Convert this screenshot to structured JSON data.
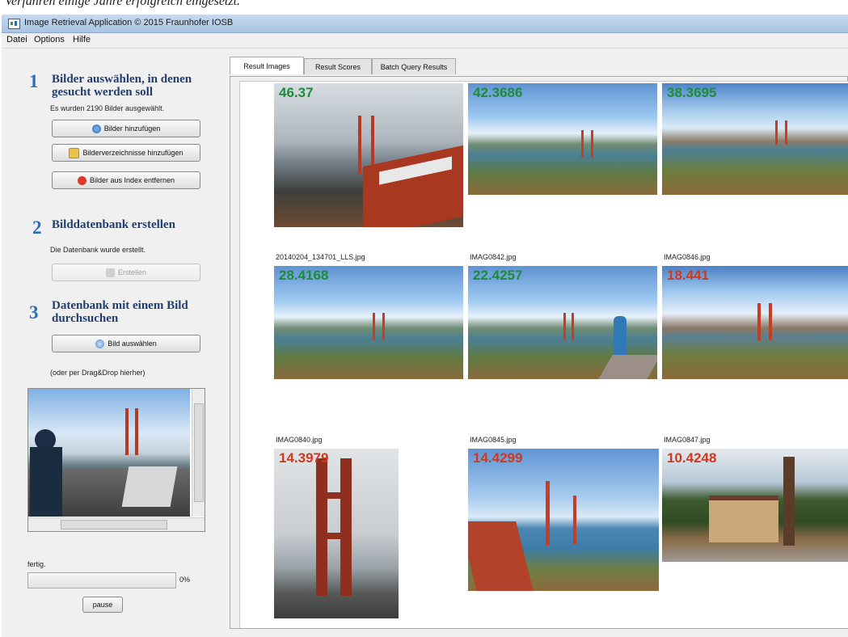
{
  "caption": "Verfahren einige Jahre erfolgreich eingesetzt.",
  "window": {
    "title": "Image Retrieval Application © 2015 Fraunhofer IOSB"
  },
  "menu": [
    "Datei",
    "Options",
    "Hilfe"
  ],
  "steps": {
    "one": {
      "number": "1",
      "heading_line1": "Bilder auswählen, in denen",
      "heading_line2": "gesucht werden soll",
      "status": "Es wurden 2190 Bilder ausgewählt.",
      "add_images_label": "Bilder hinzufügen",
      "add_dirs_label": "Bilderverzeichnisse hinzufügen",
      "remove_label": "Bilder aus Index entfernen"
    },
    "two": {
      "number": "2",
      "heading": "Bilddatenbank erstellen",
      "status": "Die Datenbank wurde erstellt.",
      "create_label": "Erstellen"
    },
    "three": {
      "number": "3",
      "heading_line1": "Datenbank mit einem Bild",
      "heading_line2": "durchsuchen",
      "select_label": "Bild auswählen",
      "hint": "(oder per Drag&Drop hierher)"
    }
  },
  "status": {
    "text": "fertig.",
    "progress_percent": "0%",
    "progress_value": 0,
    "pause_label": "pause"
  },
  "tabs": [
    "Result Images",
    "Result Scores",
    "Batch Query Results"
  ],
  "results": {
    "row1": [
      {
        "score": "46.37",
        "color": "#1e8c3a",
        "filename": "20140204_134701_LLS.jpg"
      },
      {
        "score": "42.3686",
        "color": "#1e8c3a",
        "filename": "IMAG0842.jpg"
      },
      {
        "score": "38.3695",
        "color": "#1e8c3a",
        "filename": "IMAG0846.jpg"
      }
    ],
    "row2": [
      {
        "score": "28.4168",
        "color": "#1e8c3a",
        "filename": "IMAG0840.jpg"
      },
      {
        "score": "22.4257",
        "color": "#1e8c3a",
        "filename": "IMAG0845.jpg"
      },
      {
        "score": "18.441",
        "color": "#d2381e",
        "filename": "IMAG0847.jpg"
      }
    ],
    "row3": [
      {
        "score": "14.3979",
        "color": "#d2381e"
      },
      {
        "score": "14.4299",
        "color": "#d2381e"
      },
      {
        "score": "10.4248",
        "color": "#d2381e"
      }
    ]
  }
}
